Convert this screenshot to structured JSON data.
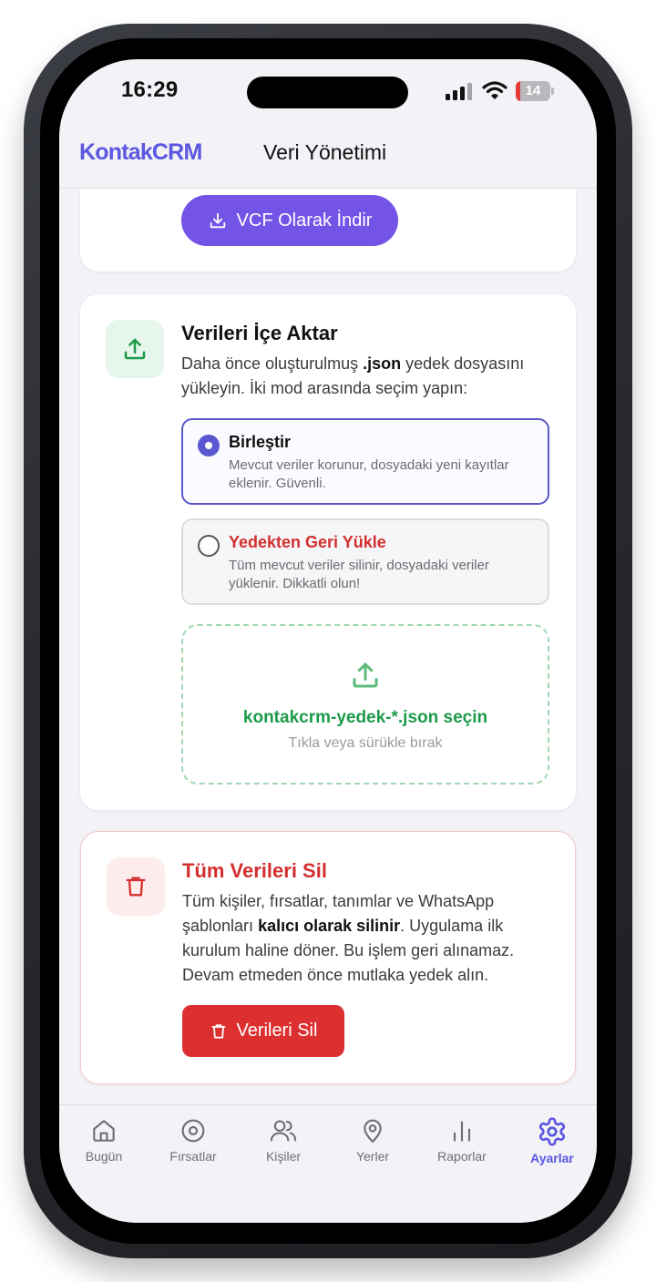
{
  "status": {
    "time": "16:29",
    "battery": "14",
    "battery_level_percent": 14
  },
  "header": {
    "brand": "KontakCRM",
    "title": "Veri Yönetimi"
  },
  "export_card": {
    "button_label": "VCF Olarak İndir"
  },
  "import_card": {
    "title": "Verileri İçe Aktar",
    "desc_prefix": "Daha önce oluşturulmuş ",
    "desc_bold": ".json",
    "desc_suffix": " yedek dosyasını yükleyin. İki mod arasında seçim yapın:",
    "options": [
      {
        "title": "Birleştir",
        "desc": "Mevcut veriler korunur, dosyadaki yeni kayıtlar eklenir. Güvenli.",
        "selected": true
      },
      {
        "title": "Yedekten Geri Yükle",
        "desc": "Tüm mevcut veriler silinir, dosyadaki veriler yüklenir. Dikkatli olun!",
        "selected": false
      }
    ],
    "dropzone_title": "kontakcrm-yedek-*.json seçin",
    "dropzone_sub": "Tıkla veya sürükle bırak"
  },
  "delete_card": {
    "title": "Tüm Verileri Sil",
    "desc_prefix": "Tüm kişiler, fırsatlar, tanımlar ve WhatsApp şablonları ",
    "desc_bold": "kalıcı olarak silinir",
    "desc_suffix": ". Uygulama ilk kurulum haline döner. Bu işlem geri alınamaz. Devam etmeden önce mutlaka yedek alın.",
    "button_label": "Verileri Sil"
  },
  "tabs": [
    {
      "label": "Bugün",
      "icon": "home-icon",
      "active": false
    },
    {
      "label": "Fırsatlar",
      "icon": "target-icon",
      "active": false
    },
    {
      "label": "Kişiler",
      "icon": "users-icon",
      "active": false
    },
    {
      "label": "Yerler",
      "icon": "map-pin-icon",
      "active": false
    },
    {
      "label": "Raporlar",
      "icon": "bar-chart-icon",
      "active": false
    },
    {
      "label": "Ayarlar",
      "icon": "gear-icon",
      "active": true
    }
  ],
  "colors": {
    "accent": "#5b57e0",
    "primary_button": "#7454e6",
    "success": "#1e9a4a",
    "danger": "#dc2f2f",
    "battery_low": "#e53935"
  }
}
